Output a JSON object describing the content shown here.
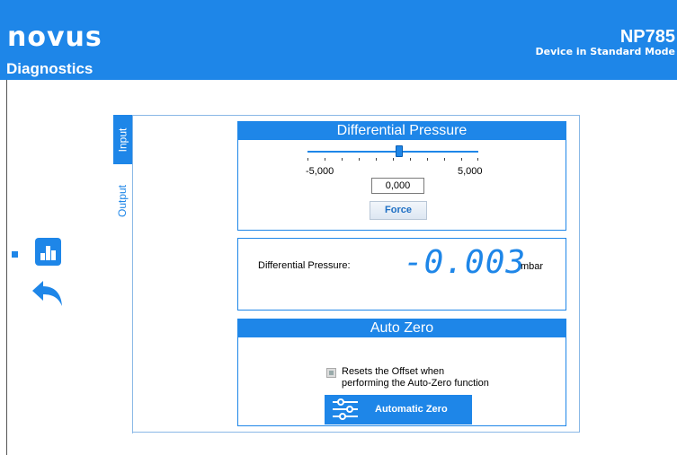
{
  "header": {
    "logo_text": "novus",
    "page_title": "Diagnostics",
    "device_name": "NP785",
    "device_mode": "Device in Standard Mode"
  },
  "tabs": {
    "input": "Input",
    "output": "Output"
  },
  "differential_pressure_panel": {
    "title": "Differential Pressure",
    "slider_min_label": "-5,000",
    "slider_max_label": "5,000",
    "slider_value": 0.0,
    "input_value": "0,000",
    "force_button": "Force"
  },
  "reading_panel": {
    "label": "Differential Pressure:",
    "value": "-0.003",
    "unit": "mbar"
  },
  "auto_zero_panel": {
    "title": "Auto Zero",
    "checkbox_line1": "Resets the Offset when",
    "checkbox_line2": "performing the Auto-Zero function",
    "checkbox_checked": false,
    "button_label": "Automatic Zero"
  },
  "icons": {
    "nav_diagnostics": "bar-chart-icon",
    "nav_back": "back-arrow-icon",
    "auto_zero": "sliders-icon"
  },
  "colors": {
    "accent": "#1e86e8"
  }
}
